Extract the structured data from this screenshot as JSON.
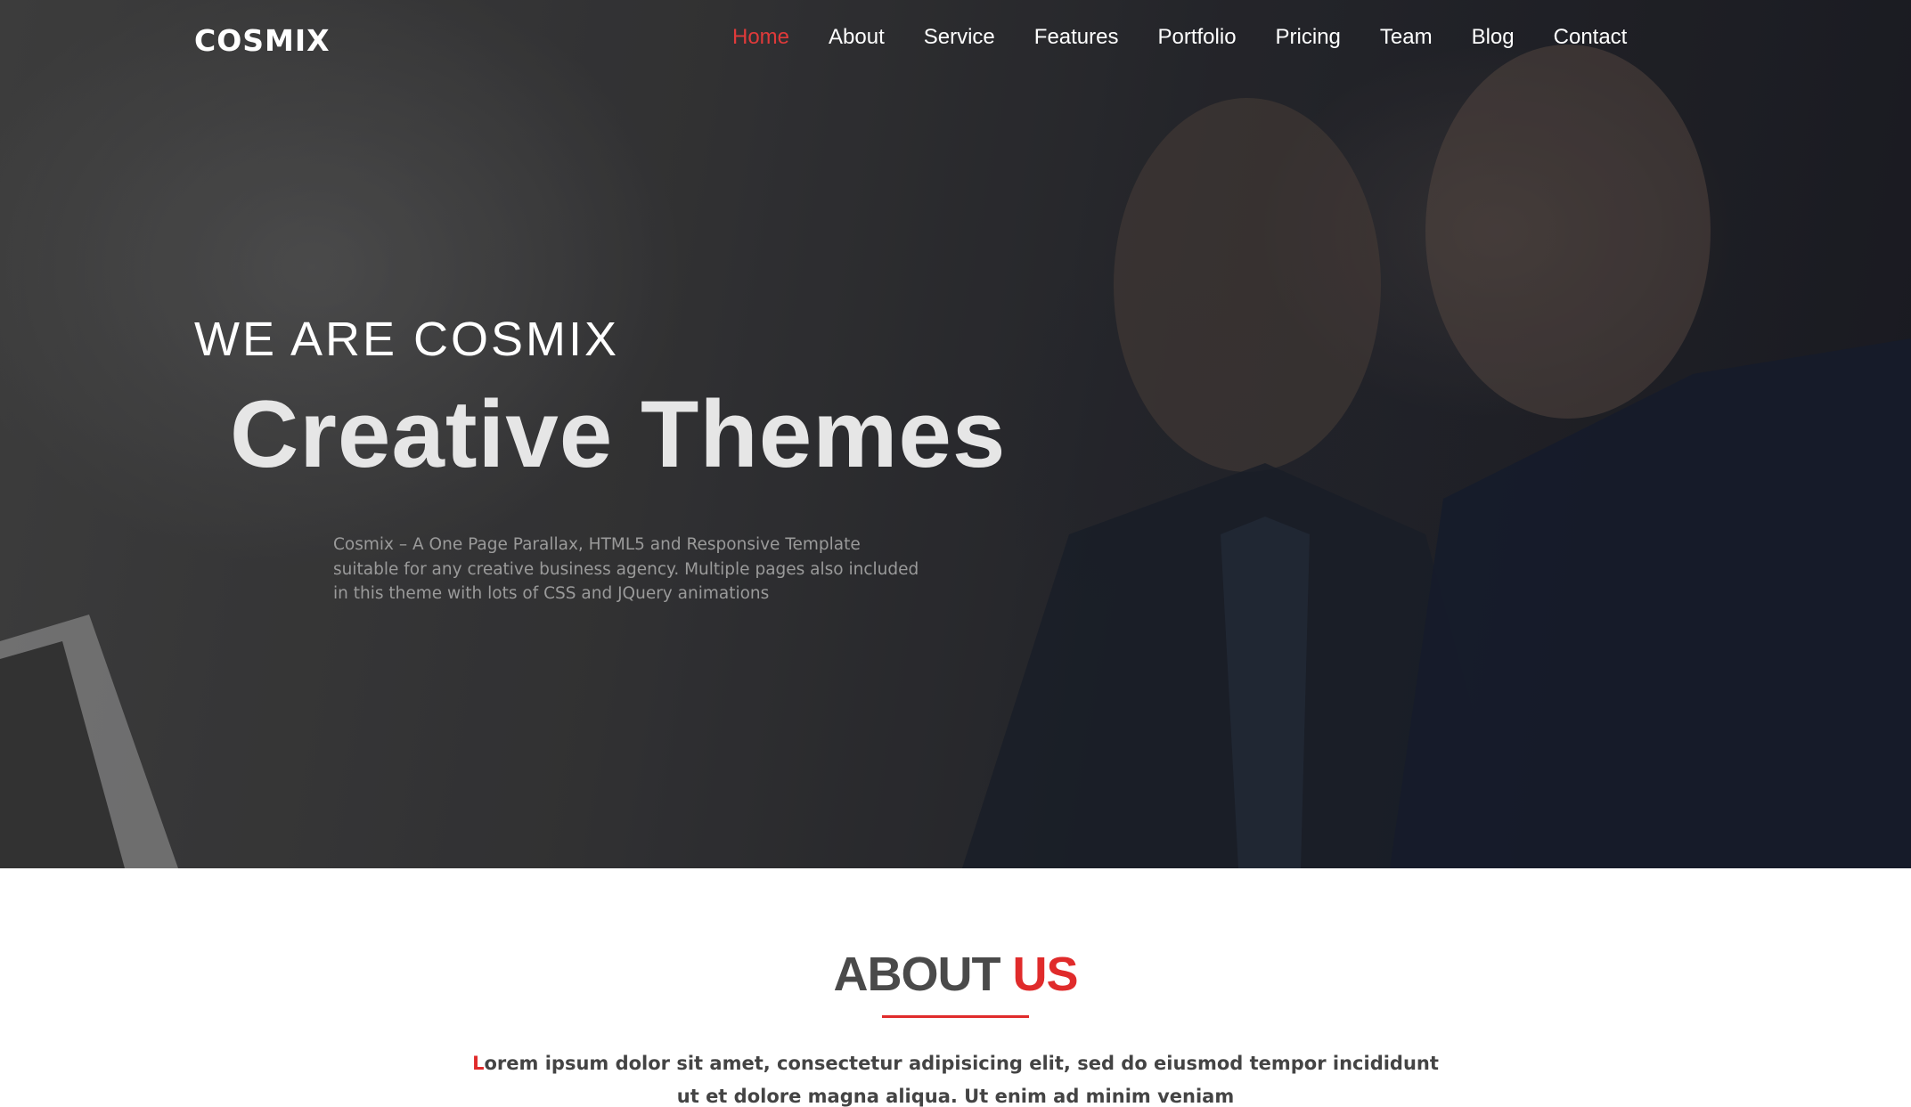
{
  "header": {
    "logo": "COSMIX",
    "nav": [
      {
        "label": "Home",
        "active": true
      },
      {
        "label": "About",
        "active": false
      },
      {
        "label": "Service",
        "active": false
      },
      {
        "label": "Features",
        "active": false
      },
      {
        "label": "Portfolio",
        "active": false
      },
      {
        "label": "Pricing",
        "active": false
      },
      {
        "label": "Team",
        "active": false
      },
      {
        "label": "Blog",
        "active": false
      },
      {
        "label": "Contact",
        "active": false
      }
    ]
  },
  "hero": {
    "eyebrow": "WE ARE COSMIX",
    "title": "Creative Themes",
    "description": "Cosmix – A One Page Parallax, HTML5 and Responsive Template suitable for any creative business agency. Multiple pages also included in this theme with lots of CSS and JQuery animations"
  },
  "about": {
    "title_main": "ABOUT",
    "title_accent": "US",
    "text_initial": "L",
    "text_rest": "orem ipsum dolor sit amet, consectetur adipisicing elit, sed do eiusmod tempor incididunt ut et dolore magna aliqua. Ut enim ad minim veniam"
  },
  "colors": {
    "accent": "#e02b2b",
    "nav_text": "#ffffff",
    "heading_dark": "#4a4a4a"
  }
}
